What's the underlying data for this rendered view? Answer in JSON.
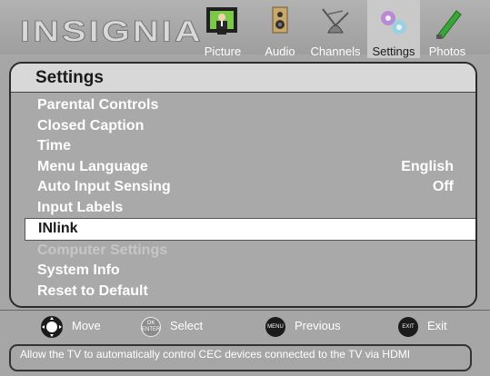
{
  "brand": {
    "logo_text": "INSIGNIA"
  },
  "tabs": [
    {
      "label": "Picture",
      "icon": "picture-icon",
      "selected": false
    },
    {
      "label": "Audio",
      "icon": "audio-icon",
      "selected": false
    },
    {
      "label": "Channels",
      "icon": "channels-icon",
      "selected": false
    },
    {
      "label": "Settings",
      "icon": "settings-icon",
      "selected": true
    },
    {
      "label": "Photos",
      "icon": "photos-icon",
      "selected": false
    }
  ],
  "panel": {
    "title": "Settings",
    "items": [
      {
        "label": "Parental Controls",
        "value": "",
        "state": "normal"
      },
      {
        "label": "Closed Caption",
        "value": "",
        "state": "normal"
      },
      {
        "label": "Time",
        "value": "",
        "state": "normal"
      },
      {
        "label": "Menu Language",
        "value": "English",
        "state": "normal"
      },
      {
        "label": "Auto Input Sensing",
        "value": "Off",
        "state": "normal"
      },
      {
        "label": "Input Labels",
        "value": "",
        "state": "normal"
      },
      {
        "label": "INlink",
        "value": "",
        "state": "selected"
      },
      {
        "label": "Computer Settings",
        "value": "",
        "state": "disabled"
      },
      {
        "label": "System Info",
        "value": "",
        "state": "normal"
      },
      {
        "label": "Reset to Default",
        "value": "",
        "state": "normal"
      }
    ]
  },
  "footer": {
    "move": {
      "label": "Move",
      "icon": "dpad-icon"
    },
    "select": {
      "label": "Select",
      "icon": "ok-enter-button-icon",
      "button_text_top": "OK",
      "button_text_bottom": "ENTER"
    },
    "previous": {
      "label": "Previous",
      "icon": "menu-button-icon",
      "button_text": "MENU"
    },
    "exit": {
      "label": "Exit",
      "icon": "exit-button-icon",
      "button_text": "EXIT"
    }
  },
  "help_text": "Allow the TV to automatically control CEC devices connected to the TV via HDMI",
  "colors": {
    "background": "#a6a6a6",
    "title_bar": "#d8d8d8",
    "highlight": "#ffffff",
    "text": "#ffffff",
    "disabled_text": "#c6c6c6"
  }
}
